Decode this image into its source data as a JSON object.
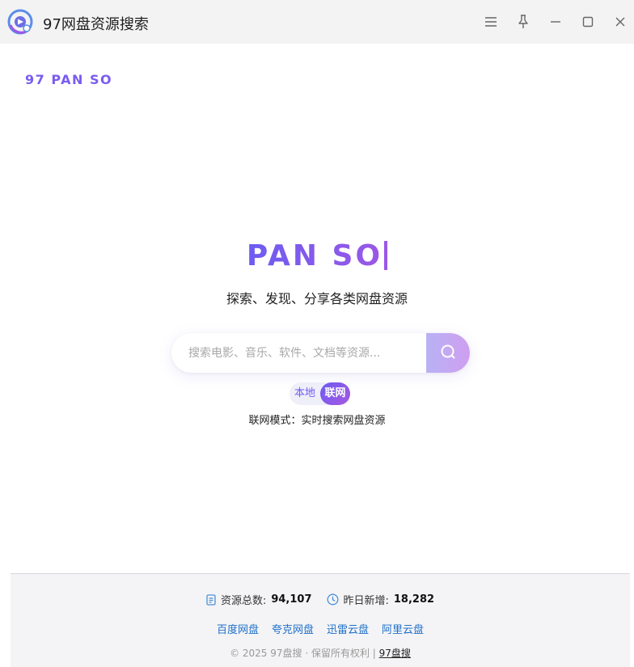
{
  "window": {
    "title": "97网盘资源搜索",
    "controls": [
      "menu-icon",
      "pin-icon",
      "minimize-icon",
      "maximize-icon",
      "close-icon"
    ]
  },
  "brand": {
    "label": "97 PAN SO",
    "color": "#7a5cf0"
  },
  "hero": {
    "title": "PAN SO",
    "subtitle": "探索、发现、分享各类网盘资源",
    "gradient": [
      "#6d5cf2",
      "#9a58e6"
    ]
  },
  "search": {
    "placeholder": "搜索电影、音乐、软件、文档等资源...",
    "value": "",
    "button_icon": "search-icon"
  },
  "mode": {
    "local_label": "本地",
    "online_label": "联网",
    "selected": "联网",
    "description": "联网模式：实时搜索网盘资源"
  },
  "footer": {
    "stats": {
      "total_label": "资源总数:",
      "total_value": "94,107",
      "total_icon": "document-icon",
      "new_label": "昨日新增:",
      "new_value": "18,282",
      "new_icon": "clock-icon"
    },
    "links": [
      "百度网盘",
      "夸克网盘",
      "迅雷云盘",
      "阿里云盘"
    ],
    "copyright_prefix": "© 2025 97盘搜 · 保留所有权利 |",
    "copyright_link": "97盘搜"
  }
}
